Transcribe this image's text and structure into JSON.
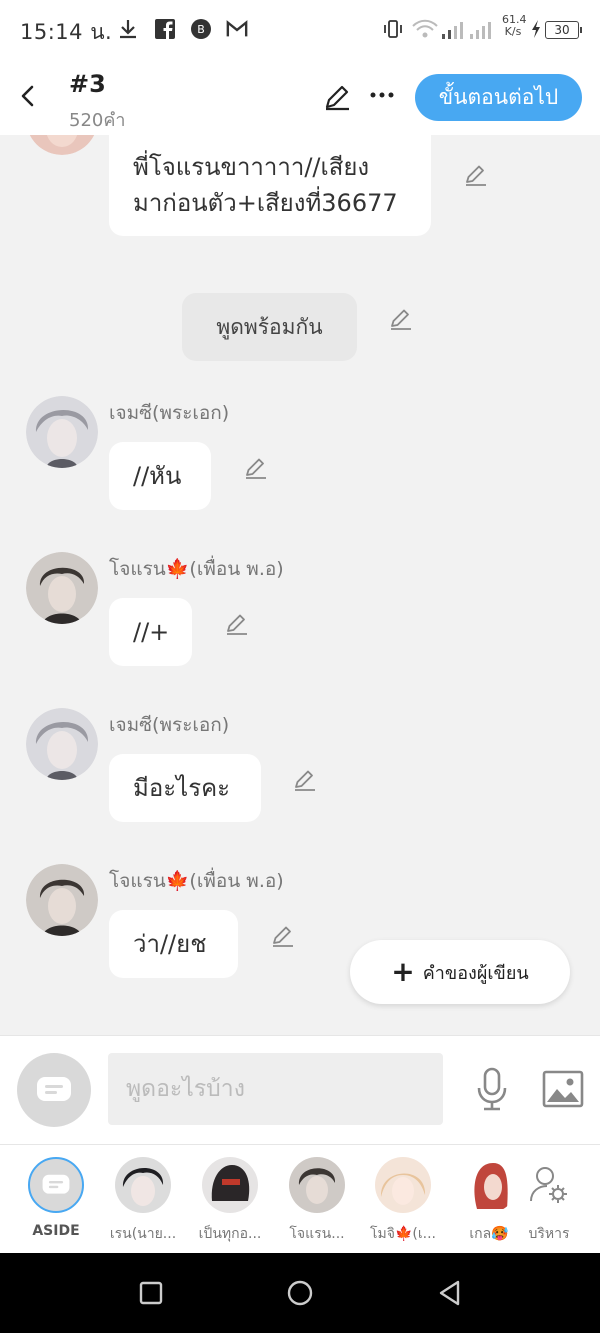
{
  "status_bar": {
    "time": "15:14 น.",
    "net_speed_value": "61.4",
    "net_speed_unit": "K/s",
    "battery": "30"
  },
  "header": {
    "title": "#3",
    "word_count": "520คำ",
    "next_label": "ขั้นตอนต่อไป"
  },
  "messages": [
    {
      "type": "bubble",
      "text_line1": "พี่โจแรนขาาาาา//เสียง",
      "text_line2": "มาก่อนตัว+เสียงที่36677"
    },
    {
      "type": "narration",
      "text": "พูดพร้อมกัน"
    },
    {
      "type": "dialogue",
      "speaker": "เจมซี(พระเอก)",
      "text": "//หัน"
    },
    {
      "type": "dialogue",
      "speaker": "โจแรน🍁(เพื่อน พ.อ)",
      "text": "//+"
    },
    {
      "type": "dialogue",
      "speaker": "เจมซี(พระเอก)",
      "text": "มีอะไรคะ"
    },
    {
      "type": "dialogue",
      "speaker": "โจแรน🍁(เพื่อน พ.อ)",
      "text": "ว่า//ยช"
    }
  ],
  "author_button": {
    "label": "คำของผู้เขียน"
  },
  "composer": {
    "placeholder": "พูดอะไรบ้าง"
  },
  "characters": [
    {
      "label": "ASIDE"
    },
    {
      "label": "เรน(นาย..."
    },
    {
      "label": "เป็นทุกอ..."
    },
    {
      "label": "โจแรน..."
    },
    {
      "label": "โมจิ🍁(เ..."
    },
    {
      "label": "เกล🥵"
    },
    {
      "label": "บริหาร"
    }
  ],
  "colors": {
    "accent": "#48a8f2",
    "background": "#f2f2f2"
  }
}
